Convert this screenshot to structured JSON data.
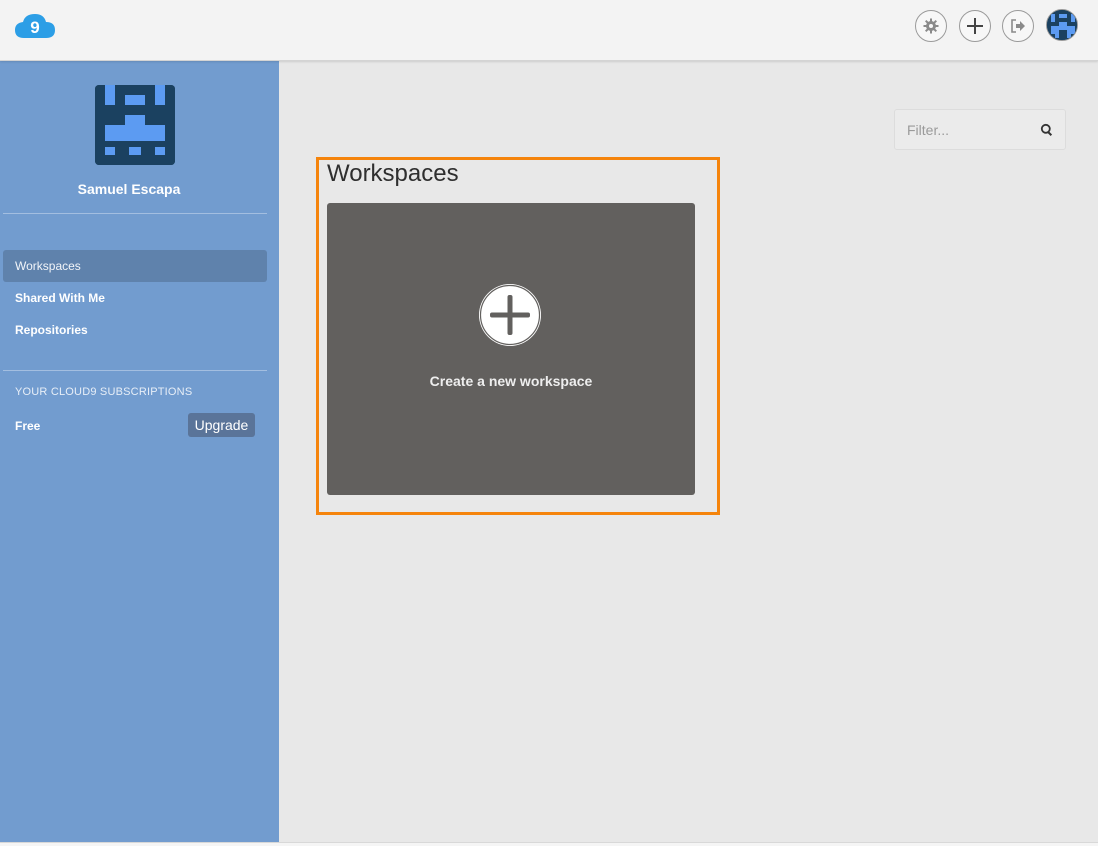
{
  "app": {
    "logo_icon": "cloud9-logo-icon",
    "brand_color": "#2c9ee6"
  },
  "topbar": {
    "settings_icon": "gear-icon",
    "new_icon": "plus-icon",
    "logout_icon": "sign-out-icon",
    "avatar_icon": "user-avatar-icon"
  },
  "sidebar": {
    "user_name": "Samuel Escapa",
    "nav": [
      {
        "label": "Workspaces",
        "active": true
      },
      {
        "label": "Shared With Me",
        "active": false
      },
      {
        "label": "Repositories",
        "active": false
      }
    ],
    "subscriptions_header": "YOUR CLOUD9 SUBSCRIPTIONS",
    "plan": "Free",
    "upgrade_label": "Upgrade",
    "background": "#729ccf"
  },
  "main": {
    "filter_placeholder": "Filter...",
    "section_title": "Workspaces",
    "create_label": "Create a new workspace",
    "highlight_color": "#f5840c"
  }
}
